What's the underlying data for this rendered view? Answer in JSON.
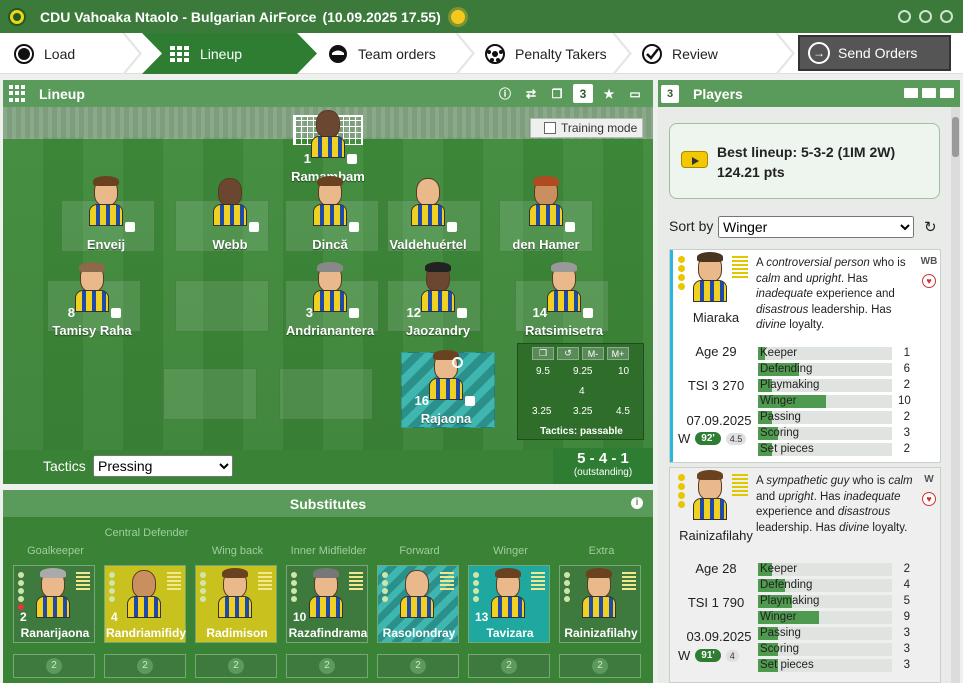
{
  "titlebar": {
    "title": "CDU Vahoaka Ntaolo - Bulgarian AirForce",
    "datetime": "(10.09.2025 17.55)"
  },
  "steps": {
    "load": "Load",
    "lineup": "Lineup",
    "team_orders": "Team orders",
    "penalty_takers": "Penalty Takers",
    "review": "Review",
    "send_orders": "Send Orders"
  },
  "lineup": {
    "title": "Lineup",
    "training_mode": "Training mode",
    "tactics_label": "Tactics",
    "tactics_value": "Pressing",
    "formation": "5 - 4 - 1",
    "formation_quality": "(outstanding)",
    "players": [
      {
        "num": "1",
        "name": "Ramambam"
      },
      {
        "num": "",
        "name": "Enveij"
      },
      {
        "num": "",
        "name": "Webb"
      },
      {
        "num": "",
        "name": "Dincă"
      },
      {
        "num": "",
        "name": "Valdehuértel"
      },
      {
        "num": "",
        "name": "den Hamer"
      },
      {
        "num": "8",
        "name": "Tamisy Raha"
      },
      {
        "num": "3",
        "name": "Andrianantera"
      },
      {
        "num": "12",
        "name": "Jaozandry"
      },
      {
        "num": "14",
        "name": "Ratsimisetra"
      },
      {
        "num": "16",
        "name": "Rajaona"
      }
    ],
    "minimap": {
      "buttons": [
        "M-",
        "M+"
      ],
      "values": [
        "9.5",
        "9.25",
        "10",
        "4",
        "3.25",
        "3.25",
        "4.5"
      ],
      "tactics_quality": "Tactics: passable"
    }
  },
  "substitutes": {
    "title": "Substitutes",
    "categories": [
      "Goalkeeper",
      "Central Defender",
      "Wing back",
      "Inner Midfielder",
      "Forward",
      "Winger",
      "Extra"
    ],
    "cards": [
      {
        "num": "2",
        "name": "Ranarijaona"
      },
      {
        "num": "4",
        "name": "Randriamifidy"
      },
      {
        "num": "",
        "name": "Radimison"
      },
      {
        "num": "10",
        "name": "Razafindrama"
      },
      {
        "num": "",
        "name": "Rasolondray"
      },
      {
        "num": "13",
        "name": "Tavizara"
      },
      {
        "num": "",
        "name": "Rainizafilahy"
      }
    ],
    "slot_number": "2"
  },
  "players_panel": {
    "title": "Players",
    "best_lineup": "Best lineup: 5-3-2 (1IM 2W)",
    "best_points": "124.21 pts",
    "sort_label": "Sort by",
    "sort_value": "Winger",
    "cards": [
      {
        "name": "Miaraka",
        "desc_html": "A <em>controversial person</em> who is <em>calm</em> and <em>upright</em>. Has <em>inadequate</em> experience and <em>disastrous</em> leadership. Has <em>divine</em> loyalty.",
        "pos": "WB",
        "age": "Age 29",
        "tsi": "TSI 3 270",
        "date": "07.09.2025",
        "form_letter": "W",
        "minutes": "92'",
        "rating": "4.5",
        "skills": [
          {
            "name": "Keeper",
            "value": 1
          },
          {
            "name": "Defending",
            "value": 6
          },
          {
            "name": "Playmaking",
            "value": 2
          },
          {
            "name": "Winger",
            "value": 10
          },
          {
            "name": "Passing",
            "value": 2
          },
          {
            "name": "Scoring",
            "value": 3
          },
          {
            "name": "Set pieces",
            "value": 2
          }
        ]
      },
      {
        "name": "Rainizafilahy",
        "desc_html": "A <em>sympathetic guy</em> who is <em>calm</em> and <em>upright</em>. Has <em>inadequate</em> experience and <em>disastrous</em> leadership. Has <em>divine</em> loyalty.",
        "pos": "W",
        "age": "Age 28",
        "tsi": "TSI 1 790",
        "date": "03.09.2025",
        "form_letter": "W",
        "minutes": "91'",
        "rating": "4",
        "skills": [
          {
            "name": "Keeper",
            "value": 2
          },
          {
            "name": "Defending",
            "value": 4
          },
          {
            "name": "Playmaking",
            "value": 5
          },
          {
            "name": "Winger",
            "value": 9
          },
          {
            "name": "Passing",
            "value": 3
          },
          {
            "name": "Scoring",
            "value": 3
          },
          {
            "name": "Set pieces",
            "value": 3
          }
        ]
      }
    ]
  },
  "colors": {
    "primary_green": "#2e7d32",
    "header_green": "#5a9a5a",
    "pitch_green": "#3a8236",
    "accent_cyan": "#2bb6e0"
  }
}
